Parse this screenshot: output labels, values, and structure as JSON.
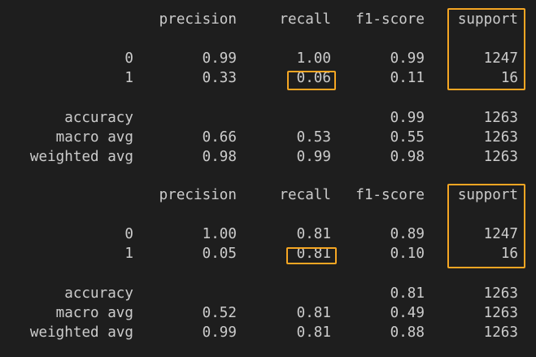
{
  "headers": [
    "precision",
    "recall",
    "f1-score",
    "support"
  ],
  "accent_color": "#f5a623",
  "reports": [
    {
      "class_rows": [
        {
          "label": "0",
          "precision": "0.99",
          "recall": "1.00",
          "f1": "0.99",
          "support": "1247"
        },
        {
          "label": "1",
          "precision": "0.33",
          "recall": "0.06",
          "f1": "0.11",
          "support": "16"
        }
      ],
      "accuracy": {
        "label": "accuracy",
        "f1": "0.99",
        "support": "1263"
      },
      "avg_rows": [
        {
          "label": "macro avg",
          "precision": "0.66",
          "recall": "0.53",
          "f1": "0.55",
          "support": "1263"
        },
        {
          "label": "weighted avg",
          "precision": "0.98",
          "recall": "0.99",
          "f1": "0.98",
          "support": "1263"
        }
      ]
    },
    {
      "class_rows": [
        {
          "label": "0",
          "precision": "1.00",
          "recall": "0.81",
          "f1": "0.89",
          "support": "1247"
        },
        {
          "label": "1",
          "precision": "0.05",
          "recall": "0.81",
          "f1": "0.10",
          "support": "16"
        }
      ],
      "accuracy": {
        "label": "accuracy",
        "f1": "0.81",
        "support": "1263"
      },
      "avg_rows": [
        {
          "label": "macro avg",
          "precision": "0.52",
          "recall": "0.81",
          "f1": "0.49",
          "support": "1263"
        },
        {
          "label": "weighted avg",
          "precision": "0.99",
          "recall": "0.81",
          "f1": "0.88",
          "support": "1263"
        }
      ]
    }
  ]
}
